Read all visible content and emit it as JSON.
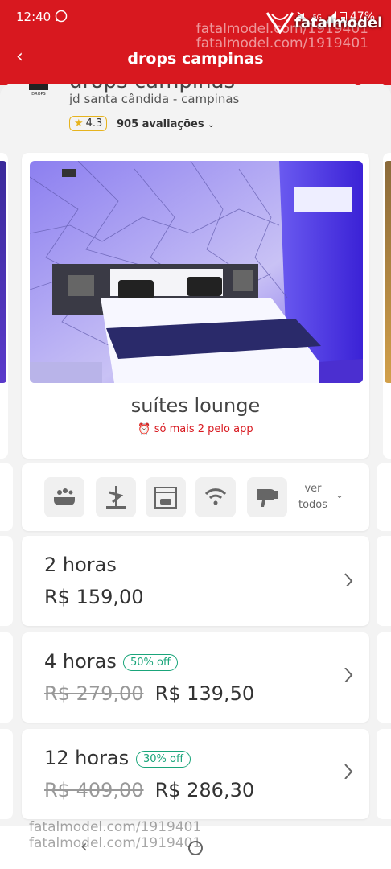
{
  "status": {
    "time": "12:40",
    "network": "5G",
    "battery": "47%"
  },
  "header": {
    "title": "drops campinas"
  },
  "watermark": {
    "line1": "fatalmodel.com/1919401",
    "line2": "fatalmodel.com/1919401"
  },
  "hotel": {
    "name": "drops campinas",
    "logo_text": "DROPS",
    "location": "jd santa cândida - campinas",
    "rating": "4.3",
    "reviews": "905 avaliações"
  },
  "room": {
    "name": "suítes lounge",
    "availability": "só mais 2 pelo app"
  },
  "amenities": {
    "icons": [
      "bathtub-icon",
      "pole-dance-icon",
      "garage-icon",
      "wifi-icon",
      "hair-dryer-icon"
    ],
    "more_line1": "ver",
    "more_line2": "todos"
  },
  "prices": [
    {
      "duration": "2 horas",
      "discount": "",
      "old_price": "",
      "price": "R$ 159,00"
    },
    {
      "duration": "4 horas",
      "discount": "50% off",
      "old_price": "R$ 279,00",
      "price": "R$ 139,50"
    },
    {
      "duration": "12 horas",
      "discount": "30% off",
      "old_price": "R$ 409,00",
      "price": "R$ 286,30"
    }
  ],
  "branding": {
    "app_name": "fatalmodel",
    "bottom_watermark1": "fatalmodel.com/1919401",
    "bottom_watermark2": "fatalmodel.com/1919401"
  },
  "colors": {
    "brand_red": "#d8181f",
    "discount_green": "#1aa57a",
    "rating_star": "#e6b31e"
  }
}
